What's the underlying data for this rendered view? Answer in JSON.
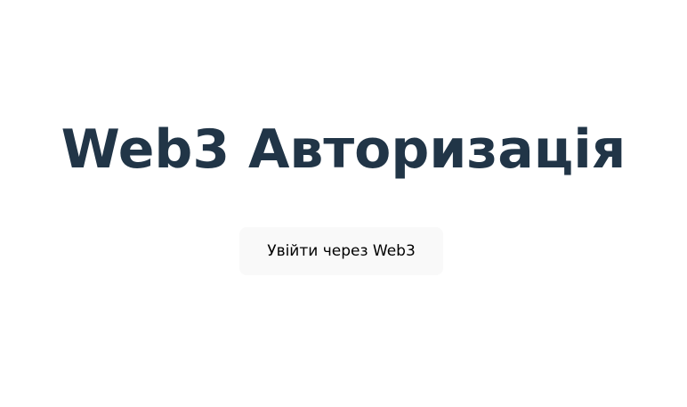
{
  "page": {
    "title": "Web3 Авторизація",
    "login_button_label": "Увійти через Web3"
  },
  "colors": {
    "background": "#ffffff",
    "title_text": "#213547",
    "button_background": "#f9f9f9",
    "button_text": "#000000"
  }
}
